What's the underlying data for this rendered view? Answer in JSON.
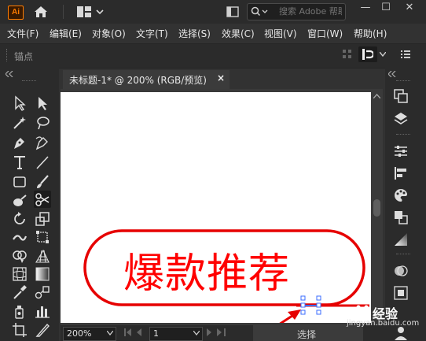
{
  "app": {
    "logo": "Ai"
  },
  "search": {
    "placeholder": "搜索 Adobe 帮助"
  },
  "window_controls": {
    "minimize": "—",
    "restore": "☐",
    "close": "✕"
  },
  "menu": [
    {
      "label": "文件(F)"
    },
    {
      "label": "编辑(E)"
    },
    {
      "label": "对象(O)"
    },
    {
      "label": "文字(T)"
    },
    {
      "label": "选择(S)"
    },
    {
      "label": "效果(C)"
    },
    {
      "label": "视图(V)"
    },
    {
      "label": "窗口(W)"
    },
    {
      "label": "帮助(H)"
    }
  ],
  "controlbar": {
    "label": "锚点"
  },
  "document": {
    "tab_title": "未标题-1* @ 200% (RGB/预览)",
    "close": "×"
  },
  "artwork": {
    "text": "爆款推荐",
    "color": "#ff0000"
  },
  "status": {
    "zoom": "200%",
    "page": "1",
    "mode": "选择"
  },
  "watermark": {
    "brand": "经验",
    "url": "jingyan.baidu.com"
  },
  "colors": {
    "accent_orange": "#ff7c00",
    "stroke_red": "#e60000",
    "selection_blue": "#3b6cff"
  }
}
